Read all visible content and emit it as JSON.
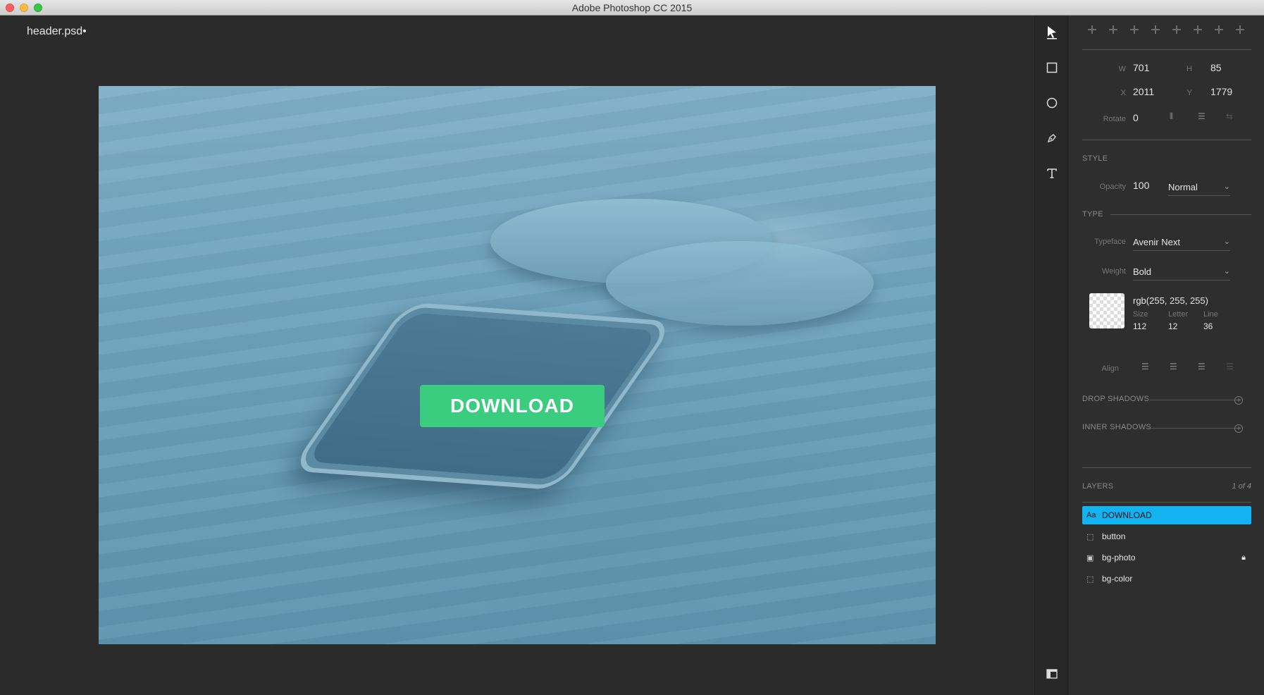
{
  "window": {
    "title": "Adobe Photoshop CC 2015"
  },
  "document": {
    "name": "header.psd•"
  },
  "canvas": {
    "button_label": "DOWNLOAD",
    "button_color": "#3acc7f",
    "overlay_color": "#6a9ab4"
  },
  "tools": [
    "select-arrow",
    "rectangle",
    "ellipse",
    "pen",
    "text"
  ],
  "properties": {
    "w_label": "W",
    "w_value": "701",
    "h_label": "H",
    "h_value": "85",
    "x_label": "X",
    "x_value": "2011",
    "y_label": "Y",
    "y_value": "1779",
    "rotate_label": "Rotate",
    "rotate_value": "0"
  },
  "style": {
    "section": "STYLE",
    "opacity_label": "Opacity",
    "opacity_value": "100",
    "blend_mode": "Normal"
  },
  "type": {
    "section": "TYPE",
    "typeface_label": "Typeface",
    "typeface": "Avenir Next",
    "weight_label": "Weight",
    "weight": "Bold",
    "color": "rgb(255, 255, 255)",
    "size_label": "Size",
    "size": "112",
    "letter_label": "Letter",
    "letter": "12",
    "line_label": "Line",
    "line": "36",
    "align_label": "Align"
  },
  "effects": {
    "drop_shadows": "DROP SHADOWS",
    "inner_shadows": "INNER SHADOWS"
  },
  "layers": {
    "section": "LAYERS",
    "count": "1 of 4",
    "items": [
      {
        "icon": "Aa",
        "name": "DOWNLOAD"
      },
      {
        "icon": "⬚",
        "name": "button"
      },
      {
        "icon": "▣",
        "name": "bg-photo"
      },
      {
        "icon": "⬚",
        "name": "bg-color"
      }
    ],
    "selected_color": "#13b3f2"
  }
}
